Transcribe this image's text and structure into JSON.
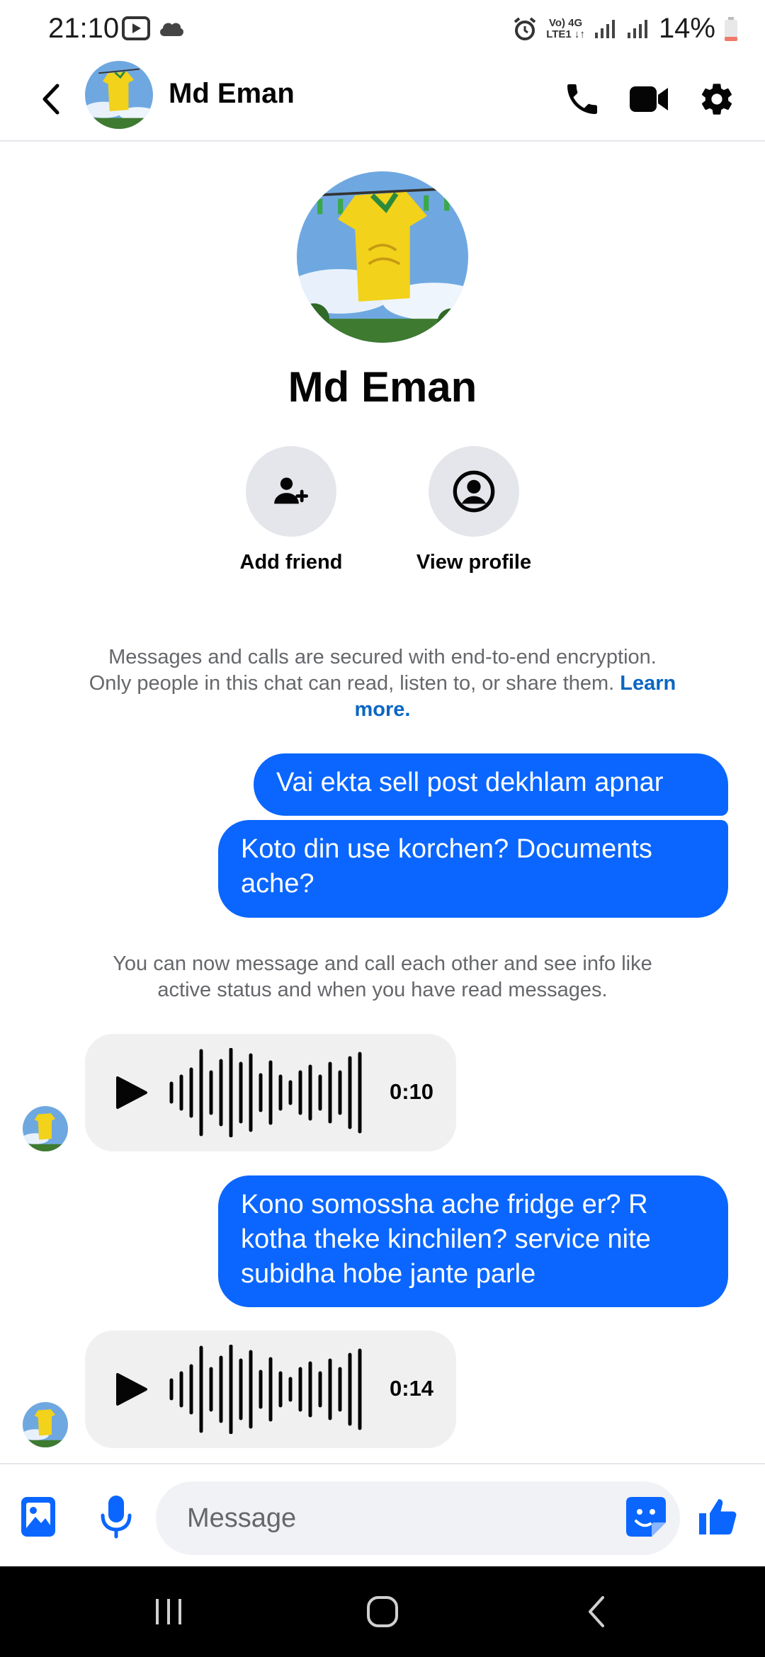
{
  "status_bar": {
    "time": "21:10",
    "battery": "14%",
    "network_top": "Vo) 4G",
    "network_bottom": "LTE1 ↓↑"
  },
  "header": {
    "name": "Md Eman"
  },
  "profile": {
    "name": "Md Eman",
    "add_friend_label": "Add friend",
    "view_profile_label": "View profile"
  },
  "notices": {
    "encryption_text": "Messages and calls are secured with end-to-end encryption. Only people in this chat can read, listen to, or share them.",
    "learn_more": "Learn more.",
    "connected_text": "You can now message and call each other and see info like active status and when you have read messages."
  },
  "messages": [
    {
      "direction": "outgoing",
      "type": "text",
      "text": "Vai ekta sell post dekhlam apnar"
    },
    {
      "direction": "outgoing",
      "type": "text",
      "text": "Koto din use korchen? Documents ache?"
    },
    {
      "direction": "incoming",
      "type": "voice",
      "duration": "0:10"
    },
    {
      "direction": "outgoing",
      "type": "text",
      "text": "Kono somossha ache fridge er? R kotha theke kinchilen?  service nite subidha hobe jante parle"
    },
    {
      "direction": "incoming",
      "type": "voice",
      "duration": "0:14"
    }
  ],
  "composer": {
    "placeholder": "Message"
  },
  "colors": {
    "accent": "#0a66ff",
    "link": "#0a66c2",
    "incoming_bubble": "#f0f0f0",
    "muted_text": "#65676b"
  },
  "icons": [
    "back-arrow-icon",
    "phone-icon",
    "video-camera-icon",
    "gear-icon",
    "add-person-icon",
    "profile-icon",
    "play-icon",
    "waveform-icon",
    "image-icon",
    "microphone-icon",
    "sticker-icon",
    "thumbs-up-icon"
  ]
}
